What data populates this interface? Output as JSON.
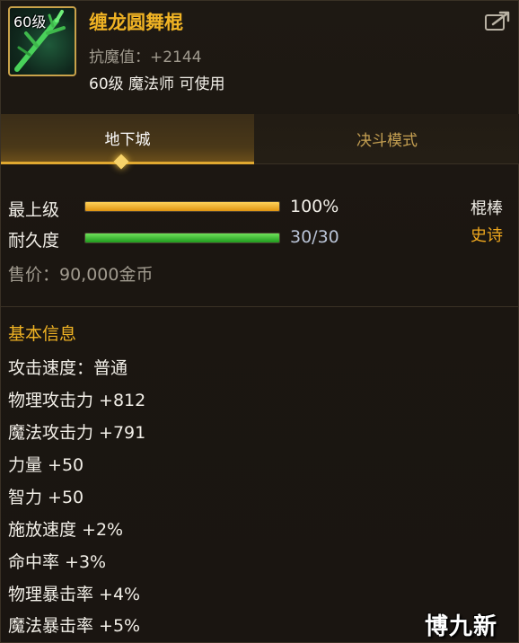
{
  "item": {
    "level_badge": "60级",
    "name": "缠龙圆舞棍",
    "resist": "抗魔值：+2144",
    "requirement": "60级 魔法师 可使用"
  },
  "tabs": [
    {
      "label": "地下城",
      "active": true
    },
    {
      "label": "决斗模式",
      "active": false
    }
  ],
  "stats": {
    "upgrade_label": "最上级",
    "upgrade_value": "100%",
    "upgrade_fraction": 1.0,
    "durability_label": "耐久度",
    "durability_value": "30/30",
    "durability_fraction": 1.0,
    "weapon_type": "棍棒",
    "rarity": "史诗",
    "price": "售价：90,000金币"
  },
  "basic_info": {
    "title": "基本信息",
    "attributes": [
      "攻击速度：普通",
      "物理攻击力 +812",
      "魔法攻击力 +791",
      "力量 +50",
      "智力 +50",
      "施放速度 +2%",
      "命中率 +3%",
      "物理暴击率 +4%",
      "魔法暴击率 +5%"
    ]
  },
  "watermark": "博九新游",
  "colors": {
    "gold": "#f0b324",
    "rarity_epic": "#f0a81e",
    "durability_bar": "#1f9a1e",
    "upgrade_bar": "#e09410"
  },
  "icons": {
    "item": "staff-icon",
    "share": "share-icon"
  }
}
